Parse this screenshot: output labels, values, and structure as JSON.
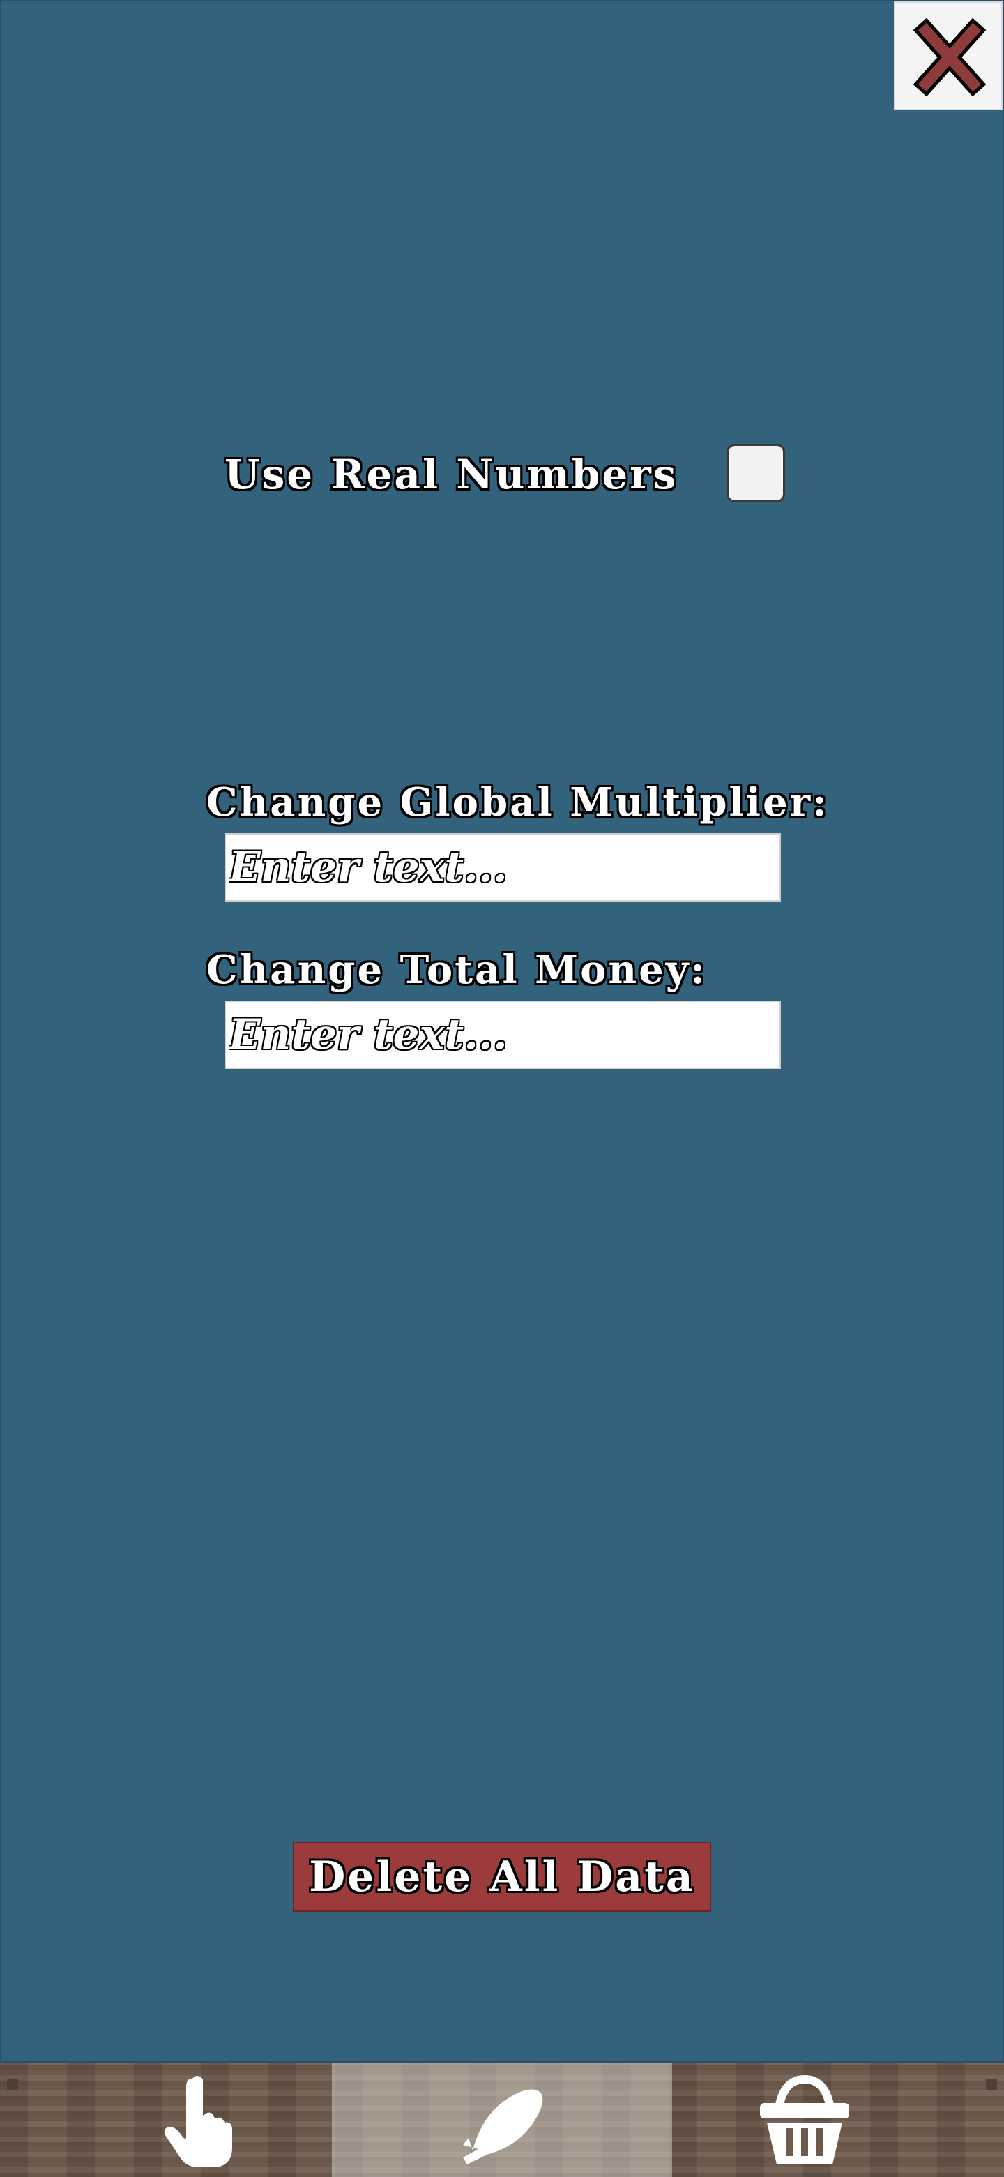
{
  "settings": {
    "close_icon": "close-x-icon",
    "real_numbers_label": "Use Real Numbers",
    "real_numbers_checked": false,
    "multiplier_label": "Change Global Multiplier:",
    "multiplier_placeholder": "Enter text...",
    "money_label": "Change Total Money:",
    "money_placeholder": "Enter text...",
    "delete_button_label": "Delete All Data"
  },
  "bottom_nav": {
    "tabs": [
      {
        "icon": "hand-pointer-icon",
        "active": false
      },
      {
        "icon": "fish-icon",
        "active": true
      },
      {
        "icon": "basket-icon",
        "active": false
      }
    ]
  },
  "colors": {
    "background": "#33627c",
    "close_x": "#8e3b3b",
    "delete_button": "#9c3b3b",
    "nav_wood": "#6f5b4c"
  }
}
